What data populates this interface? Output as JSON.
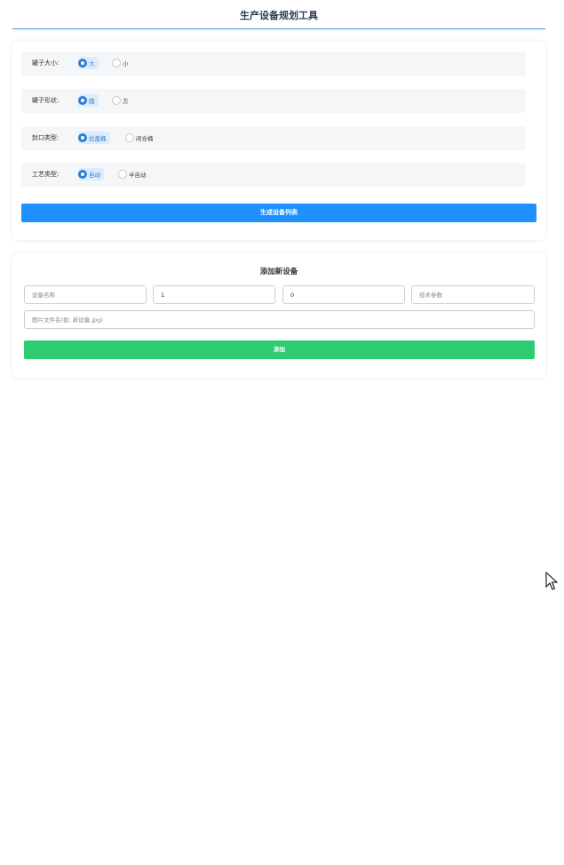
{
  "header": {
    "title": "生产设备规划工具"
  },
  "options": [
    {
      "label": "罐子大小:",
      "choices": [
        "大",
        "小"
      ],
      "selected": 0
    },
    {
      "label": "罐子形状:",
      "choices": [
        "圆",
        "方"
      ],
      "selected": 0
    },
    {
      "label": "封口类型:",
      "choices": [
        "拉盖桶",
        "闭合桶"
      ],
      "selected": 0
    },
    {
      "label": "工艺类型:",
      "choices": [
        "自动",
        "半自动"
      ],
      "selected": 0
    }
  ],
  "generate_button": "生成设备列表",
  "add_section": {
    "title": "添加新设备",
    "name_placeholder": "设备名称",
    "quantity_value": "1",
    "price_value": "0",
    "spec_placeholder": "技术参数",
    "image_placeholder": "图片文件名(如: 新设备.jpg)",
    "add_button": "添加"
  },
  "colors": {
    "accent": "#1e90ff",
    "add": "#2ecc71",
    "selected_radio": "#2a7fd4"
  }
}
